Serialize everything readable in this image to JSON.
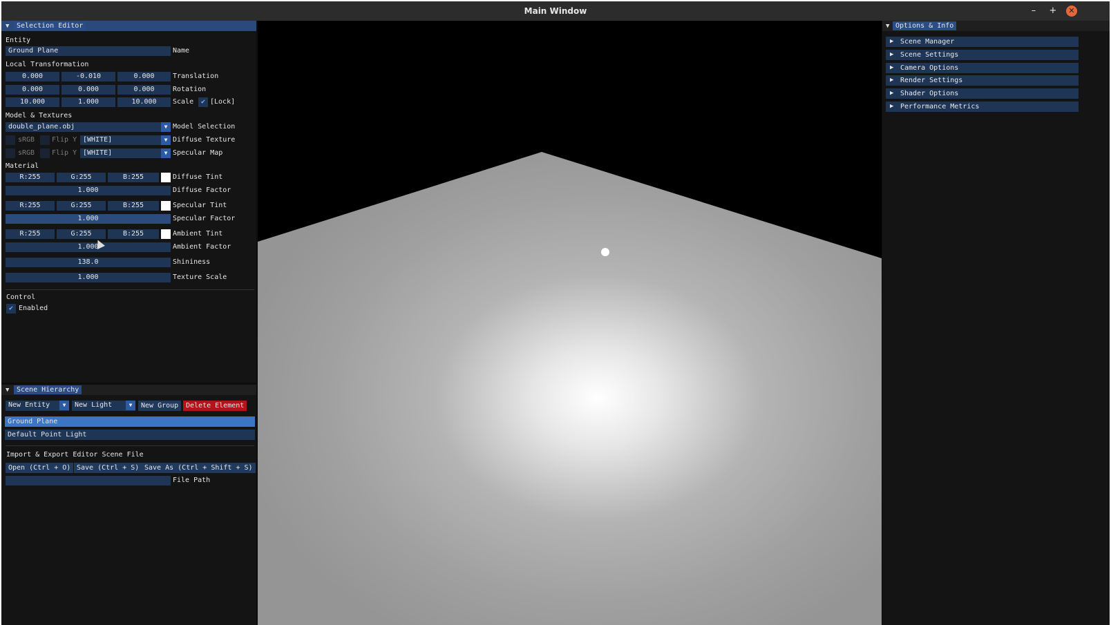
{
  "window": {
    "title": "Main Window",
    "minimize": "–",
    "maximize": "+",
    "close": "✕"
  },
  "selection_editor": {
    "title": "Selection Editor",
    "entity_header": "Entity",
    "name_value": "Ground Plane",
    "name_label": "Name",
    "local_transformation_header": "Local Transformation",
    "translation": [
      "0.000",
      "-0.010",
      "0.000"
    ],
    "translation_label": "Translation",
    "rotation": [
      "0.000",
      "0.000",
      "0.000"
    ],
    "rotation_label": "Rotation",
    "scale": [
      "10.000",
      "1.000",
      "10.000"
    ],
    "scale_label": "Scale",
    "lock_label": "[Lock]",
    "model_textures_header": "Model & Textures",
    "model_value": "double_plane.obj",
    "model_label": "Model Selection",
    "srgb_label": "sRGB",
    "flipy_label": "Flip Y",
    "diffuse_texture_value": "[WHITE]",
    "diffuse_texture_label": "Diffuse Texture",
    "specular_map_value": "[WHITE]",
    "specular_map_label": "Specular Map",
    "material_header": "Material",
    "diffuse_tint": [
      "R:255",
      "G:255",
      "B:255"
    ],
    "diffuse_tint_label": "Diffuse Tint",
    "diffuse_factor": "1.000",
    "diffuse_factor_label": "Diffuse Factor",
    "specular_tint": [
      "R:255",
      "G:255",
      "B:255"
    ],
    "specular_tint_label": "Specular Tint",
    "specular_factor": "1.000",
    "specular_factor_label": "Specular Factor",
    "ambient_tint": [
      "R:255",
      "G:255",
      "B:255"
    ],
    "ambient_tint_label": "Ambient Tint",
    "ambient_factor": "1.000",
    "ambient_factor_label": "Ambient Factor",
    "shininess": "138.0",
    "shininess_label": "Shininess",
    "texture_scale": "1.000",
    "texture_scale_label": "Texture Scale",
    "control_header": "Control",
    "enabled_label": "Enabled"
  },
  "scene_hierarchy": {
    "title": "Scene Hierarchy",
    "new_entity": "New Entity",
    "new_light": "New Light",
    "new_group": "New Group",
    "delete_element": "Delete Element",
    "items": [
      "Ground Plane",
      "Default Point Light"
    ],
    "import_export_header": "Import & Export Editor Scene File",
    "open": "Open (Ctrl + O)",
    "save": "Save (Ctrl + S)",
    "save_as": "Save As (Ctrl + Shift + S)",
    "file_path_value": "",
    "file_path_label": "File Path"
  },
  "options_info": {
    "title": "Options & Info",
    "sections": [
      "Scene Manager",
      "Scene Settings",
      "Camera Options",
      "Render Settings",
      "Shader Options",
      "Performance Metrics"
    ]
  },
  "icons": {
    "collapse": "triangle-down-icon",
    "expand": "triangle-right-icon",
    "check": "checkmark-icon",
    "dropdown": "dropdown-arrow-icon"
  },
  "colors": {
    "accent": "#2a4d85",
    "field": "#1e3556",
    "selected": "#3a76c4",
    "delete": "#b31417",
    "close": "#e9663a"
  }
}
